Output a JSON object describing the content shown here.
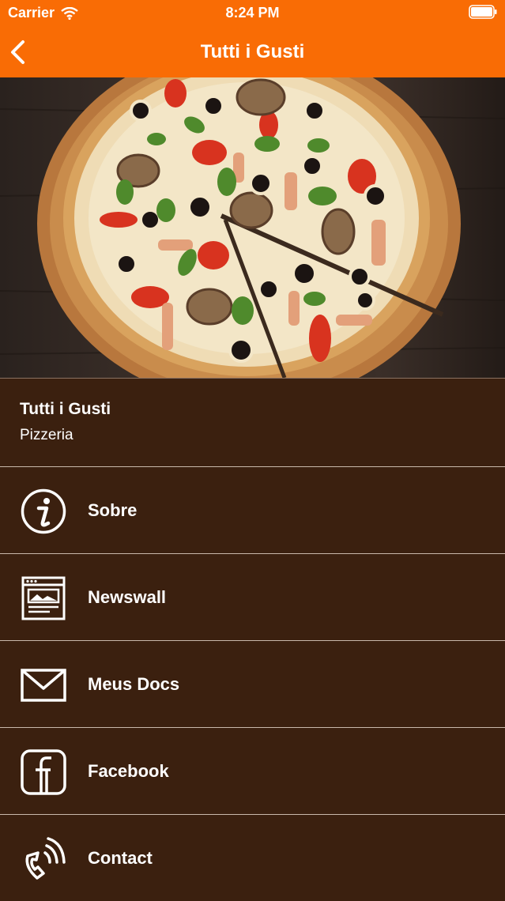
{
  "status_bar": {
    "carrier": "Carrier",
    "time": "8:24 PM"
  },
  "nav": {
    "title": "Tutti i Gusti",
    "back_icon": "chevron-left-icon"
  },
  "hero": {
    "image": "pizza-photo"
  },
  "business": {
    "name": "Tutti i Gusti",
    "category": "Pizzeria"
  },
  "menu": [
    {
      "label": "Sobre",
      "icon": "info-icon"
    },
    {
      "label": "Newswall",
      "icon": "newspaper-icon"
    },
    {
      "label": "Meus Docs",
      "icon": "envelope-icon"
    },
    {
      "label": "Facebook",
      "icon": "facebook-icon"
    },
    {
      "label": "Contact",
      "icon": "phone-icon"
    }
  ],
  "colors": {
    "header": "#f96c05",
    "background": "#3b200f",
    "text": "#ffffff"
  }
}
